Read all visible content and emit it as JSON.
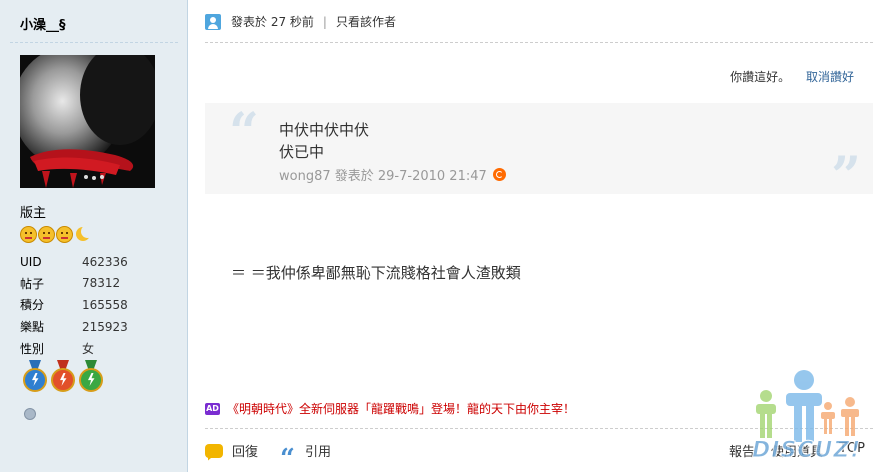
{
  "user": {
    "name": "小澡__§",
    "group": "版主",
    "stats": [
      {
        "label": "UID",
        "value": "462336"
      },
      {
        "label": "帖子",
        "value": "78312"
      },
      {
        "label": "積分",
        "value": "165558"
      },
      {
        "label": "樂點",
        "value": "215923"
      },
      {
        "label": "性別",
        "value": "女"
      }
    ]
  },
  "post": {
    "posted_text": "發表於 27 秒前",
    "separator": "|",
    "author_only": "只看該作者",
    "like_text": "你讚這好。",
    "unlike_link": "取消讚好",
    "quote": {
      "line1": "中伏中伏中伏",
      "line2": "伏已中",
      "meta": "wong87 發表於 29-7-2010 21:47"
    },
    "body": "＝ ＝我仲係卑鄙無恥下流賤格社會人渣敗類",
    "ad": {
      "badge": "AD",
      "text": "《明朝時代》全新伺服器「龍躍戰鳴」登場！龍的天下由你主宰！"
    },
    "actions": {
      "reply": "回復",
      "quote": "引用",
      "report": "報告",
      "tools": "使用道具",
      "top": "TOP"
    }
  },
  "watermark": "DISCUZ!",
  "colors": {
    "sidebar_bg": "#e5edf2",
    "link": "#336699",
    "ad_text": "#cc0000",
    "quote_bg": "#f6f6f6"
  }
}
